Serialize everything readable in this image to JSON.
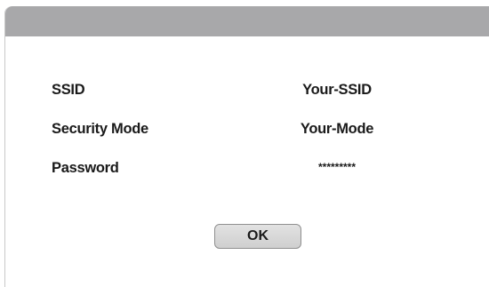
{
  "rows": [
    {
      "label": "SSID",
      "value": "Your-SSID"
    },
    {
      "label": "Security Mode",
      "value": "Your-Mode"
    },
    {
      "label": "Password",
      "value": "*********"
    }
  ],
  "actions": {
    "ok_label": "OK"
  },
  "colors": {
    "titlebar": "#a8a8aa",
    "background": "#ffffff",
    "text": "#1a1a1a",
    "button_fill": "#d9d9d9",
    "button_border": "#8f8f8f"
  }
}
